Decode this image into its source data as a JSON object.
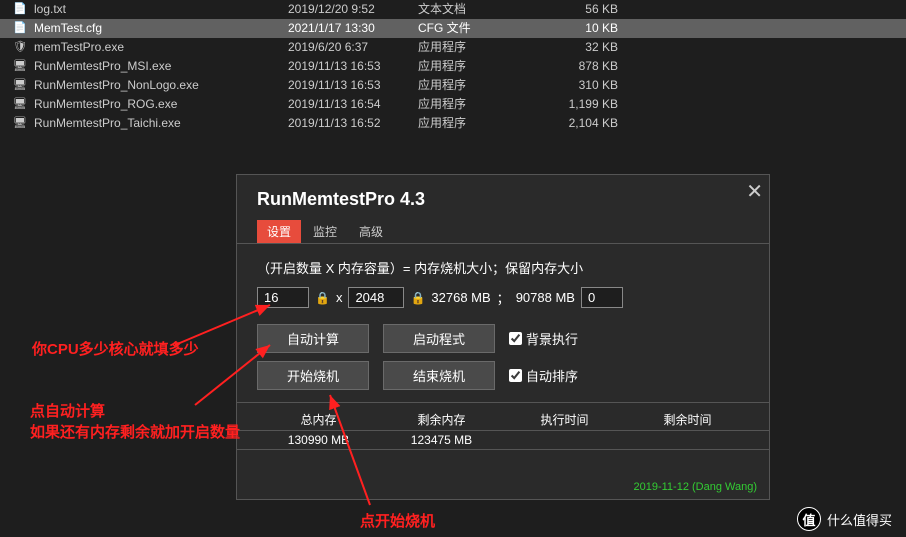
{
  "files": [
    {
      "icon": "📄",
      "name": "log.txt",
      "date": "2019/12/20 9:52",
      "type": "文本文档",
      "size": "56 KB",
      "sel": false
    },
    {
      "icon": "📄",
      "name": "MemTest.cfg",
      "date": "2021/1/17 13:30",
      "type": "CFG 文件",
      "size": "10 KB",
      "sel": true
    },
    {
      "icon": "🛡",
      "name": "memTestPro.exe",
      "date": "2019/6/20 6:37",
      "type": "应用程序",
      "size": "32 KB",
      "sel": false
    },
    {
      "icon": "🖥",
      "name": "RunMemtestPro_MSI.exe",
      "date": "2019/11/13 16:53",
      "type": "应用程序",
      "size": "878 KB",
      "sel": false
    },
    {
      "icon": "🖥",
      "name": "RunMemtestPro_NonLogo.exe",
      "date": "2019/11/13 16:53",
      "type": "应用程序",
      "size": "310 KB",
      "sel": false
    },
    {
      "icon": "🖥",
      "name": "RunMemtestPro_ROG.exe",
      "date": "2019/11/13 16:54",
      "type": "应用程序",
      "size": "1,199 KB",
      "sel": false
    },
    {
      "icon": "🖥",
      "name": "RunMemtestPro_Taichi.exe",
      "date": "2019/11/13 16:52",
      "type": "应用程序",
      "size": "2,104 KB",
      "sel": false
    }
  ],
  "dialog": {
    "title": "RunMemtestPro 4.3",
    "tabs": [
      "设置",
      "监控",
      "高级"
    ],
    "formula": "（开启数量 X 内存容量）= 内存烧机大小；保留内存大小",
    "count": "16",
    "mem": "2048",
    "reserve": "0",
    "burn_mb": "32768 MB",
    "free_mb": "90788 MB",
    "x": "x",
    "sep": "；",
    "btn_auto": "自动计算",
    "btn_startup": "启动程式",
    "btn_start": "开始烧机",
    "btn_stop": "结束烧机",
    "chk_bg": "背景执行",
    "chk_sort": "自动排序",
    "h_total": "总内存",
    "h_remain": "剩余内存",
    "h_run": "执行时间",
    "h_left": "剩余时间",
    "v_total": "130990 MB",
    "v_remain": "123475 MB",
    "v_run": "",
    "v_left": "",
    "footer": "2019-11-12 (Dang Wang)"
  },
  "anno": {
    "a1": "你CPU多少核心就填多少",
    "a2a": "点自动计算",
    "a2b": "如果还有内存剩余就加开启数量",
    "a3": "点开始烧机"
  },
  "smzdm": {
    "badge": "值",
    "text": "什么值得买"
  }
}
